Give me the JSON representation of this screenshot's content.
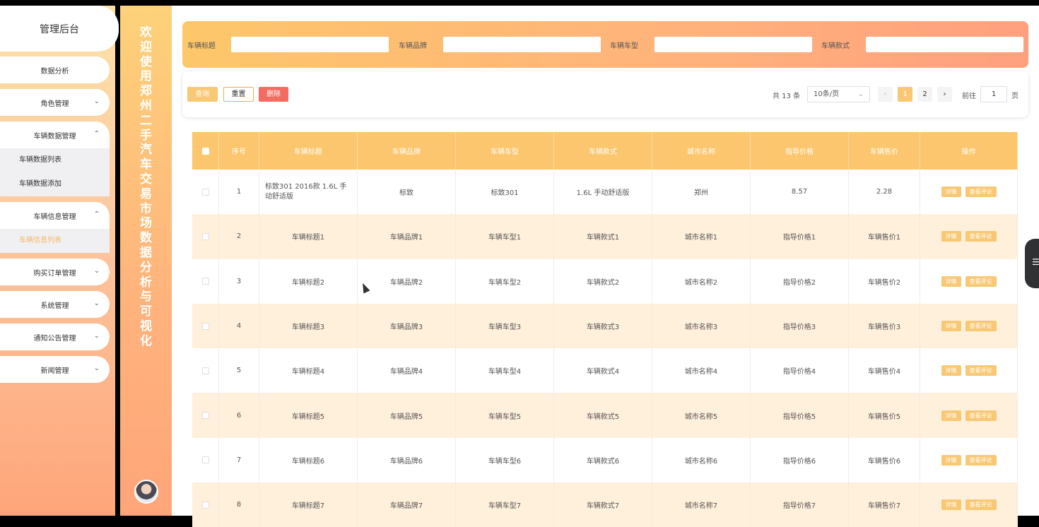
{
  "sidebar": {
    "title": "管理后台",
    "items": [
      {
        "label": "数据分析",
        "chevron": ""
      },
      {
        "label": "角色管理",
        "chevron": "⌄"
      },
      {
        "label": "车辆数据管理",
        "chevron": "⌃",
        "sub": [
          "车辆数据列表",
          "车辆数据添加"
        ]
      },
      {
        "label": "车辆信息管理",
        "chevron": "⌃",
        "sub": [
          "车辆信息列表"
        ]
      },
      {
        "label": "购买订单管理",
        "chevron": "⌄"
      },
      {
        "label": "系统管理",
        "chevron": "⌄"
      },
      {
        "label": "通知公告管理",
        "chevron": "⌄"
      },
      {
        "label": "新闻管理",
        "chevron": "⌄"
      }
    ]
  },
  "banner": {
    "text": "欢迎使用郑州二手汽车交易市场数据分析与可视化"
  },
  "search": {
    "labels": [
      "车辆标题",
      "车辆品牌",
      "车辆车型",
      "车辆款式"
    ]
  },
  "toolbar": {
    "query": "查询",
    "reset": "重置",
    "delete": "删除"
  },
  "pager": {
    "total": "共 13 条",
    "size": "10条/页",
    "prev": "‹",
    "page1": "1",
    "page2": "2",
    "next": "›",
    "goto": "前往",
    "goto_value": "1",
    "unit": "页"
  },
  "table": {
    "headers": [
      "序号",
      "车辆标题",
      "车辆品牌",
      "车辆车型",
      "车辆款式",
      "城市名称",
      "指导价格",
      "车辆售价",
      "操作"
    ],
    "actions": [
      "详情",
      "查看评论"
    ],
    "rows": [
      [
        "1",
        "标致301 2016款 1.6L 手动舒适版",
        "标致",
        "标致301",
        "1.6L 手动舒适版",
        "郑州",
        "8.57",
        "2.28"
      ],
      [
        "2",
        "车辆标题1",
        "车辆品牌1",
        "车辆车型1",
        "车辆款式1",
        "城市名称1",
        "指导价格1",
        "车辆售价1"
      ],
      [
        "3",
        "车辆标题2",
        "车辆品牌2",
        "车辆车型2",
        "车辆款式2",
        "城市名称2",
        "指导价格2",
        "车辆售价2"
      ],
      [
        "4",
        "车辆标题3",
        "车辆品牌3",
        "车辆车型3",
        "车辆款式3",
        "城市名称3",
        "指导价格3",
        "车辆售价3"
      ],
      [
        "5",
        "车辆标题4",
        "车辆品牌4",
        "车辆车型4",
        "车辆款式4",
        "城市名称4",
        "指导价格4",
        "车辆售价4"
      ],
      [
        "6",
        "车辆标题5",
        "车辆品牌5",
        "车辆车型5",
        "车辆款式5",
        "城市名称5",
        "指导价格5",
        "车辆售价5"
      ],
      [
        "7",
        "车辆标题6",
        "车辆品牌6",
        "车辆车型6",
        "车辆款式6",
        "城市名称6",
        "指导价格6",
        "车辆售价6"
      ],
      [
        "8",
        "车辆标题7",
        "车辆品牌7",
        "车辆车型7",
        "车辆款式7",
        "城市名称7",
        "指导价格7",
        "车辆售价7"
      ]
    ]
  },
  "colors": {
    "accent": "#f9c874",
    "danger": "#f46b61",
    "row_alt": "#fff0db"
  },
  "icons": {
    "sidebar_chevron": "chevron-icon",
    "side_tab": "menu-icon",
    "avatar": "avatar-image"
  }
}
